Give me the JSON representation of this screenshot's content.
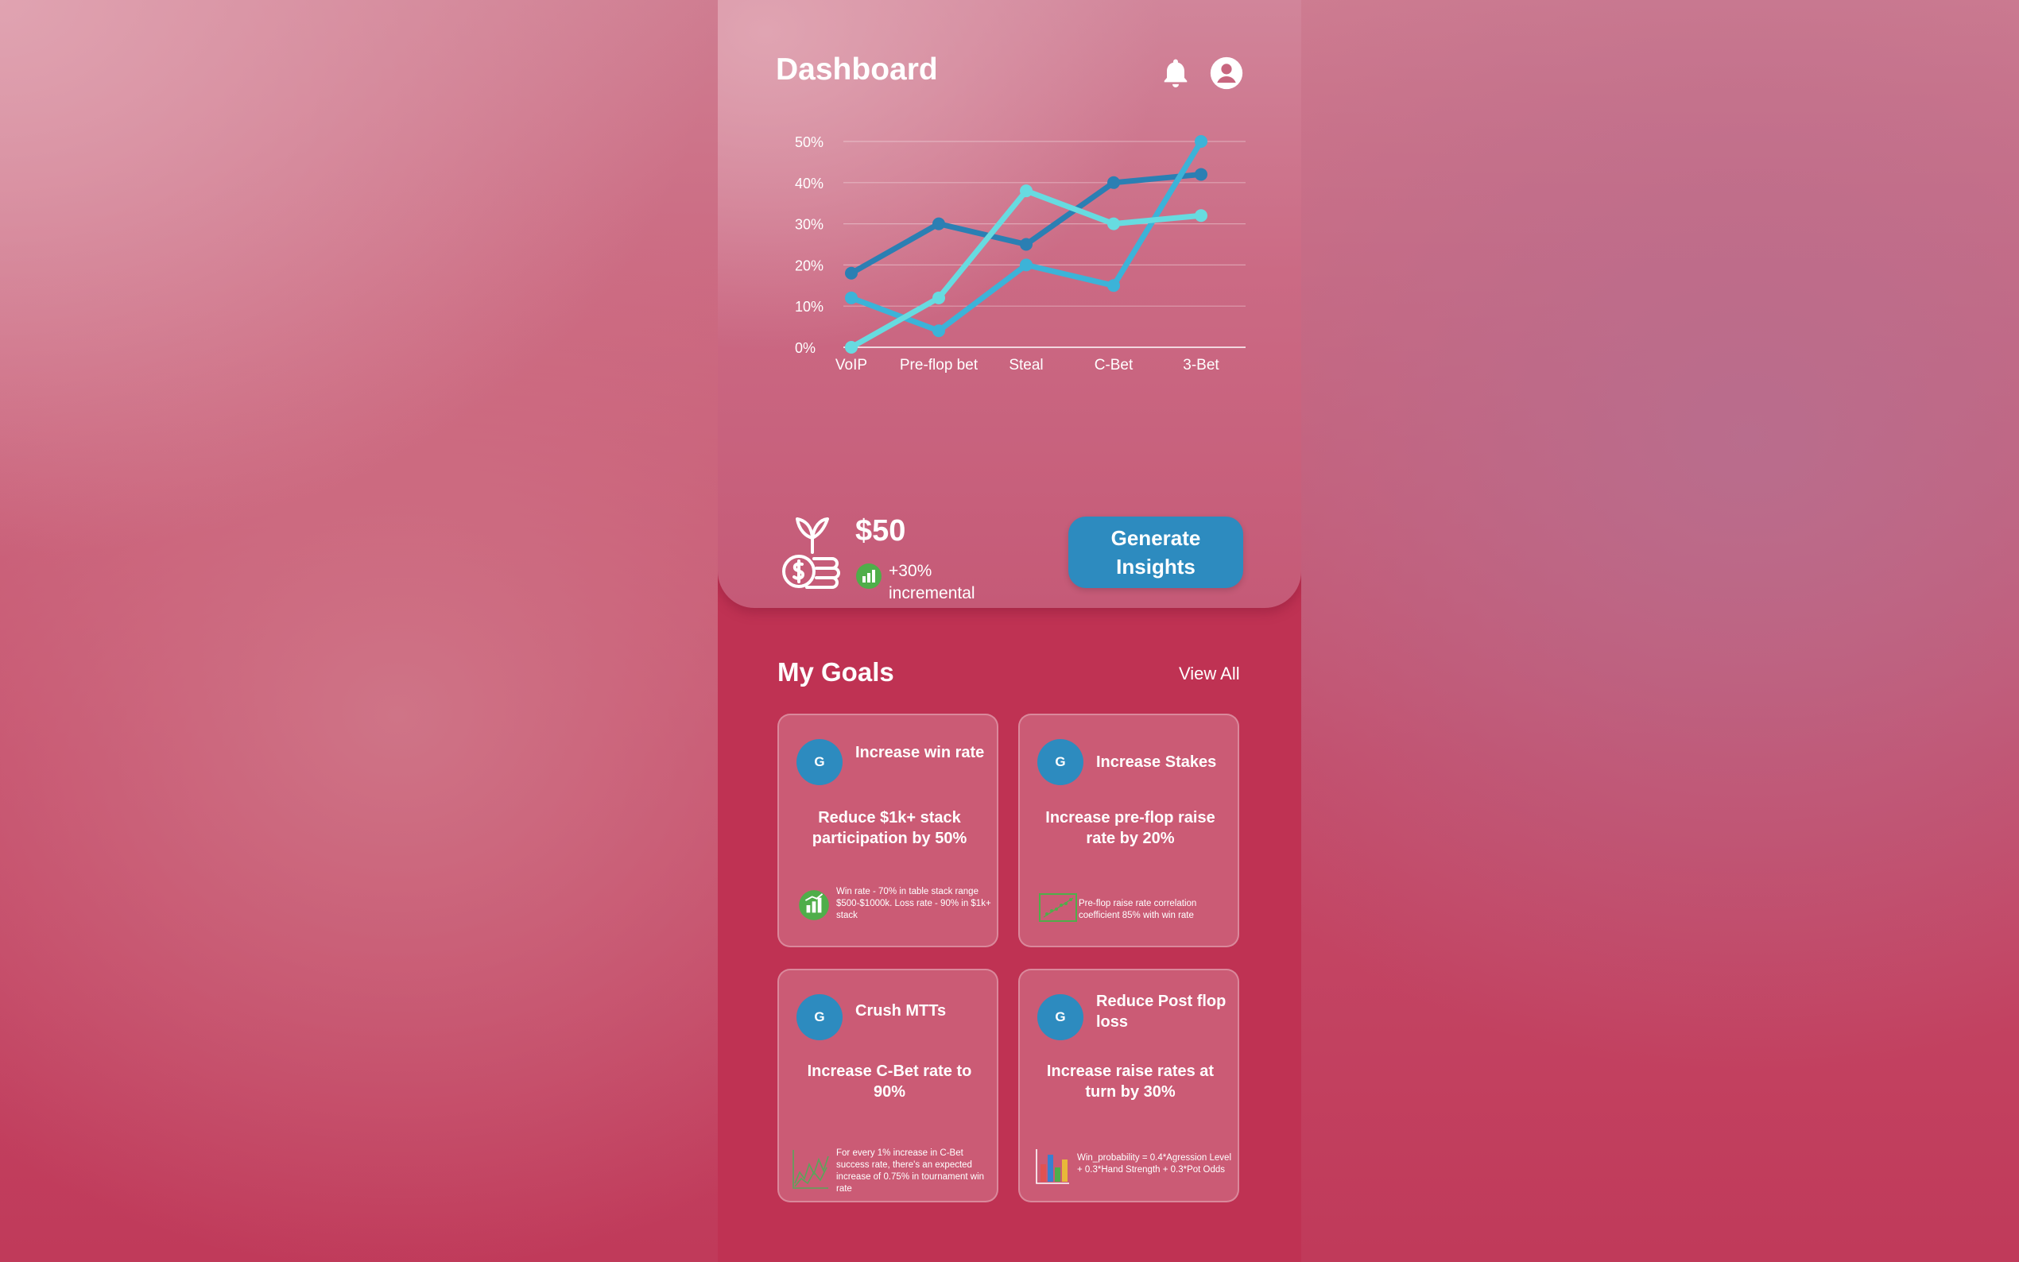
{
  "header": {
    "title": "Dashboard",
    "notifications_icon": "bell-icon",
    "profile_icon": "user-circle-icon"
  },
  "chart_data": {
    "type": "line",
    "categories": [
      "VoIP",
      "Pre-flop bet",
      "Steal",
      "C-Bet",
      "3-Bet"
    ],
    "y_ticks": [
      "0%",
      "10%",
      "20%",
      "30%",
      "40%",
      "50%"
    ],
    "ylim": [
      0,
      50
    ],
    "grid": true,
    "series": [
      {
        "color": "#2b7fb3",
        "values": [
          18,
          30,
          25,
          40,
          42
        ]
      },
      {
        "color": "#3cb3d8",
        "values": [
          12,
          4,
          20,
          15,
          50
        ]
      },
      {
        "color": "#67dbe0",
        "values": [
          0,
          12,
          38,
          30,
          32
        ]
      }
    ]
  },
  "earnings": {
    "amount": "$50",
    "change": "+30%",
    "change_label": "incremental",
    "icon": "money-plant-icon",
    "trend_icon": "bar-chart-up-icon"
  },
  "generate_button": {
    "label": "Generate Insights"
  },
  "goals": {
    "title": "My Goals",
    "view_all": "View All",
    "accent": "#2d8bbf",
    "items": [
      {
        "badge": "G",
        "name": "Increase win rate",
        "target": "Reduce $1k+ stack participation by 50%",
        "icon": "bar-chart-up-icon",
        "note": "Win rate - 70% in table stack range $500-$1000k. Loss rate - 90% in $1k+ stack"
      },
      {
        "badge": "G",
        "name": "Increase Stakes",
        "target": "Increase pre-flop raise rate by 20%",
        "icon": "scatter-plot-icon",
        "note": "Pre-flop raise rate correlation coefficient 85% with win rate"
      },
      {
        "badge": "G",
        "name": "Crush MTTs",
        "target": "Increase C-Bet rate to 90%",
        "icon": "line-chart-icon",
        "note": "For every 1% increase in C-Bet success rate, there's an expected increase of 0.75% in tournament win rate"
      },
      {
        "badge": "G",
        "name": "Reduce Post flop loss",
        "target": "Increase raise rates at turn by 30%",
        "icon": "3d-bar-chart-icon",
        "note": "Win_probability = 0.4*Agression Level + 0.3*Hand Strength + 0.3*Pot Odds"
      }
    ]
  }
}
